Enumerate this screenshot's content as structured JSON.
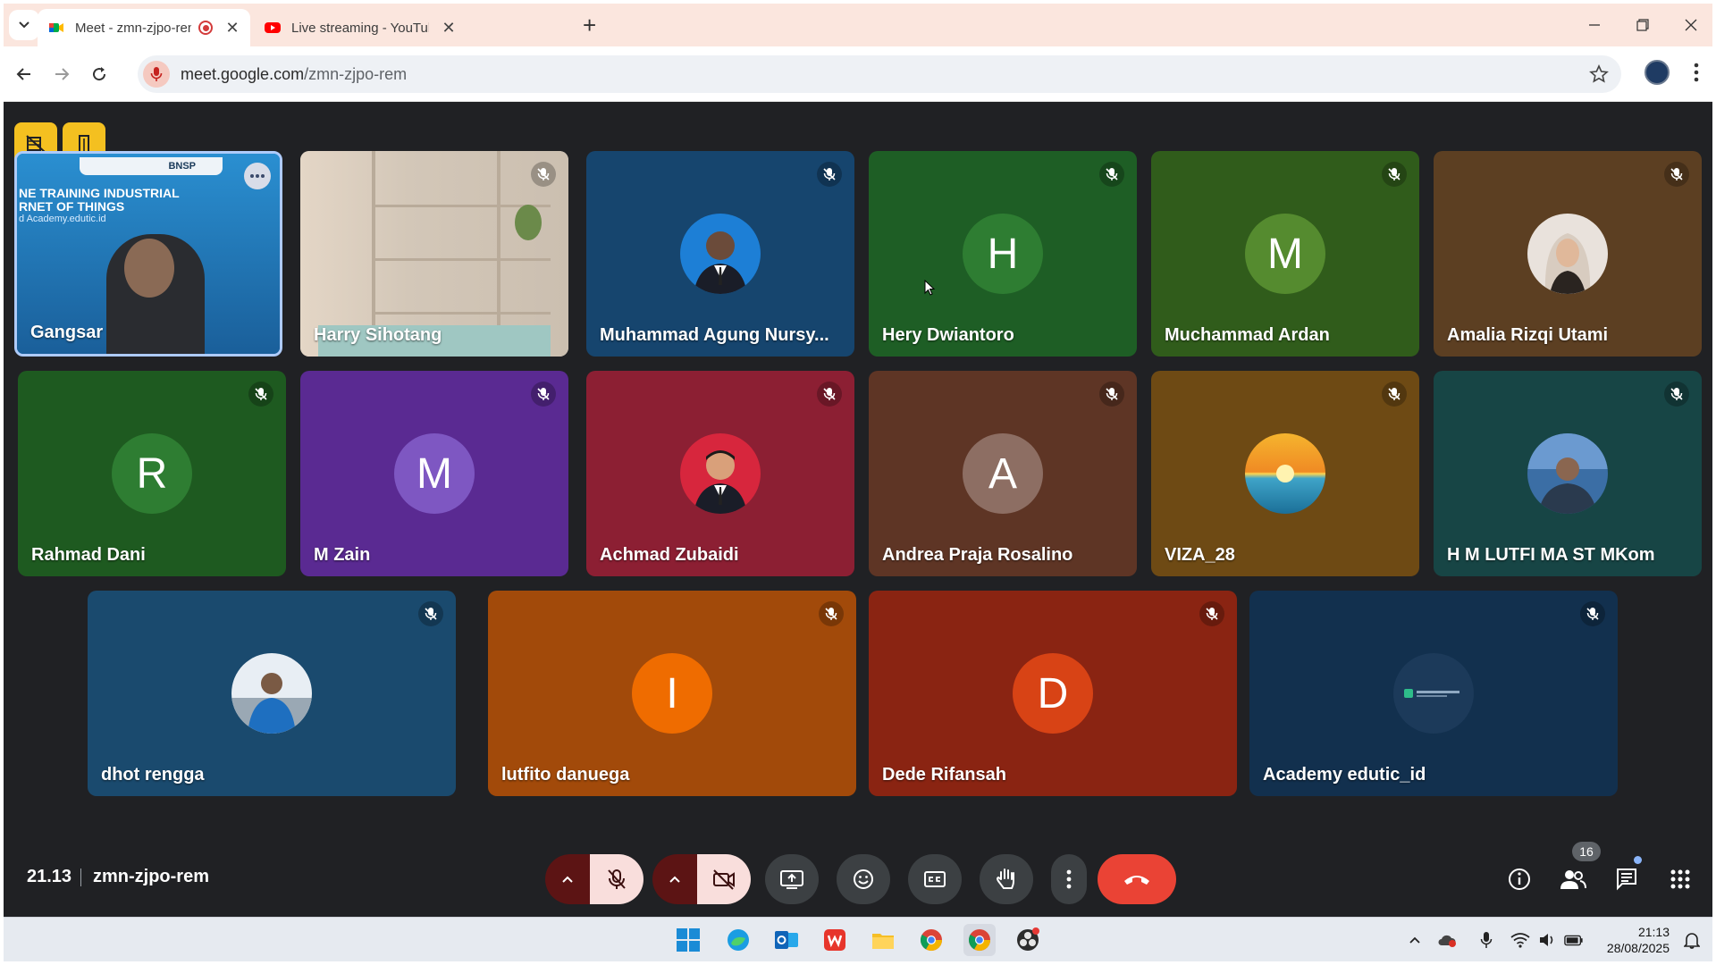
{
  "browser": {
    "tabs": [
      {
        "title": "Meet - zmn-zjpo-rem",
        "active": true,
        "recording": true
      },
      {
        "title": "Live streaming - YouTube Studio",
        "active": false,
        "recording": false
      }
    ],
    "url_host": "meet.google.com",
    "url_path": "/zmn-zjpo-rem"
  },
  "participants_row1": [
    {
      "name": "Gangsar",
      "bg": "#1b6fb0",
      "type": "video"
    },
    {
      "name": "Harry Sihotang",
      "bg": "#d9cfc2",
      "type": "video"
    },
    {
      "name": "Muhammad Agung Nursy...",
      "bg": "#16456e",
      "type": "photo",
      "avatar_color": "#1d7fd6"
    },
    {
      "name": "Hery Dwiantoro",
      "bg": "#1e5e25",
      "type": "initial",
      "initial": "H",
      "avatar_color": "#2e7d32"
    },
    {
      "name": "Muchammad Ardan",
      "bg": "#305c1b",
      "type": "initial",
      "initial": "M",
      "avatar_color": "#558b2f"
    },
    {
      "name": "Amalia Rizqi Utami",
      "bg": "#5c3f22",
      "type": "photo",
      "avatar_color": "#e9e2dc"
    }
  ],
  "participants_row2": [
    {
      "name": "Rahmad Dani",
      "bg": "#1e5a20",
      "type": "initial",
      "initial": "R",
      "avatar_color": "#2e7d32"
    },
    {
      "name": "M Zain",
      "bg": "#5a2a92",
      "type": "initial",
      "initial": "M",
      "avatar_color": "#7e57c2"
    },
    {
      "name": "Achmad Zubaidi",
      "bg": "#8c1f33",
      "type": "photo",
      "avatar_color": "#d7263d"
    },
    {
      "name": "Andrea Praja Rosalino",
      "bg": "#5e3525",
      "type": "initial",
      "initial": "A",
      "avatar_color": "#8d6e63"
    },
    {
      "name": "VIZA_28",
      "bg": "#6e4a14",
      "type": "photo",
      "avatar_color": "#f0a030"
    },
    {
      "name": "H M LUTFI MA ST MKom",
      "bg": "#174545",
      "type": "photo",
      "avatar_color": "#3b6ea5"
    }
  ],
  "participants_row3": [
    {
      "name": "dhot rengga",
      "bg": "#1a4a6e",
      "type": "photo",
      "avatar_color": "#1e6fc0"
    },
    {
      "name": "lutfito danuega",
      "bg": "#a24a0a",
      "type": "initial",
      "initial": "I",
      "avatar_color": "#ef6c00"
    },
    {
      "name": "Dede Rifansah",
      "bg": "#8a2412",
      "type": "initial",
      "initial": "D",
      "avatar_color": "#d84315"
    },
    {
      "name": "Academy edutic_id",
      "bg": "#12304e",
      "type": "logo",
      "avatar_color": "#1c3a5a"
    }
  ],
  "presenter_slide": {
    "line1": "NE TRAINING INDUSTRIAL",
    "line2": "RNET OF THINGS",
    "line3": "d Academy.edutic.id",
    "brand": "BNSP"
  },
  "meeting": {
    "time": "21.13",
    "code": "zmn-zjpo-rem",
    "people_count": "16"
  },
  "taskbar": {
    "time": "21:13",
    "date": "28/08/2025"
  },
  "colors": {
    "accent_yellow": "#f4c020",
    "hangup_red": "#ea4335",
    "meet_bg": "#202124"
  }
}
